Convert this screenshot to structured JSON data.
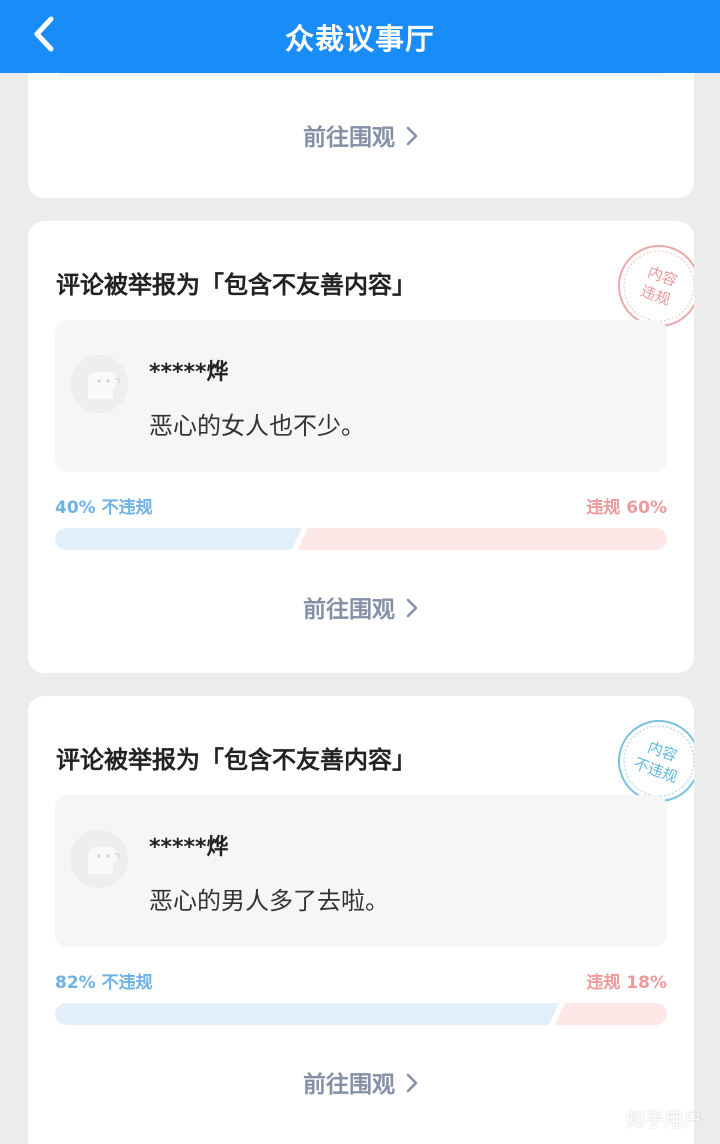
{
  "header": {
    "title": "众裁议事厅"
  },
  "top_card": {
    "link_label": "前往围观"
  },
  "cards": [
    {
      "title": "评论被举报为「包含不友善内容」",
      "stamp": [
        "内容",
        "违规"
      ],
      "stamp_color": "#e89a9a",
      "username": "*****烨",
      "comment": "恶心的女人也不少。",
      "not_violation_label": "40% 不违规",
      "violation_label": "违规 60%",
      "not_violation_pct": 40,
      "violation_pct": 60,
      "link_label": "前往围观"
    },
    {
      "title": "评论被举报为「包含不友善内容」",
      "stamp": [
        "内容",
        "不违规"
      ],
      "stamp_color": "#5fb6dc",
      "username": "*****烨",
      "comment": "恶心的男人多了去啦。",
      "not_violation_label": "82% 不违规",
      "violation_label": "违规 18%",
      "not_violation_pct": 82,
      "violation_pct": 18,
      "link_label": "前往围观"
    }
  ],
  "colors": {
    "header": "#1a8cf8",
    "not_violation": "#6fb1e6",
    "violation": "#ef9a9a",
    "not_violation_bar": "#e2effb",
    "violation_bar": "#fde7e7"
  },
  "watermark": "知乎用户"
}
